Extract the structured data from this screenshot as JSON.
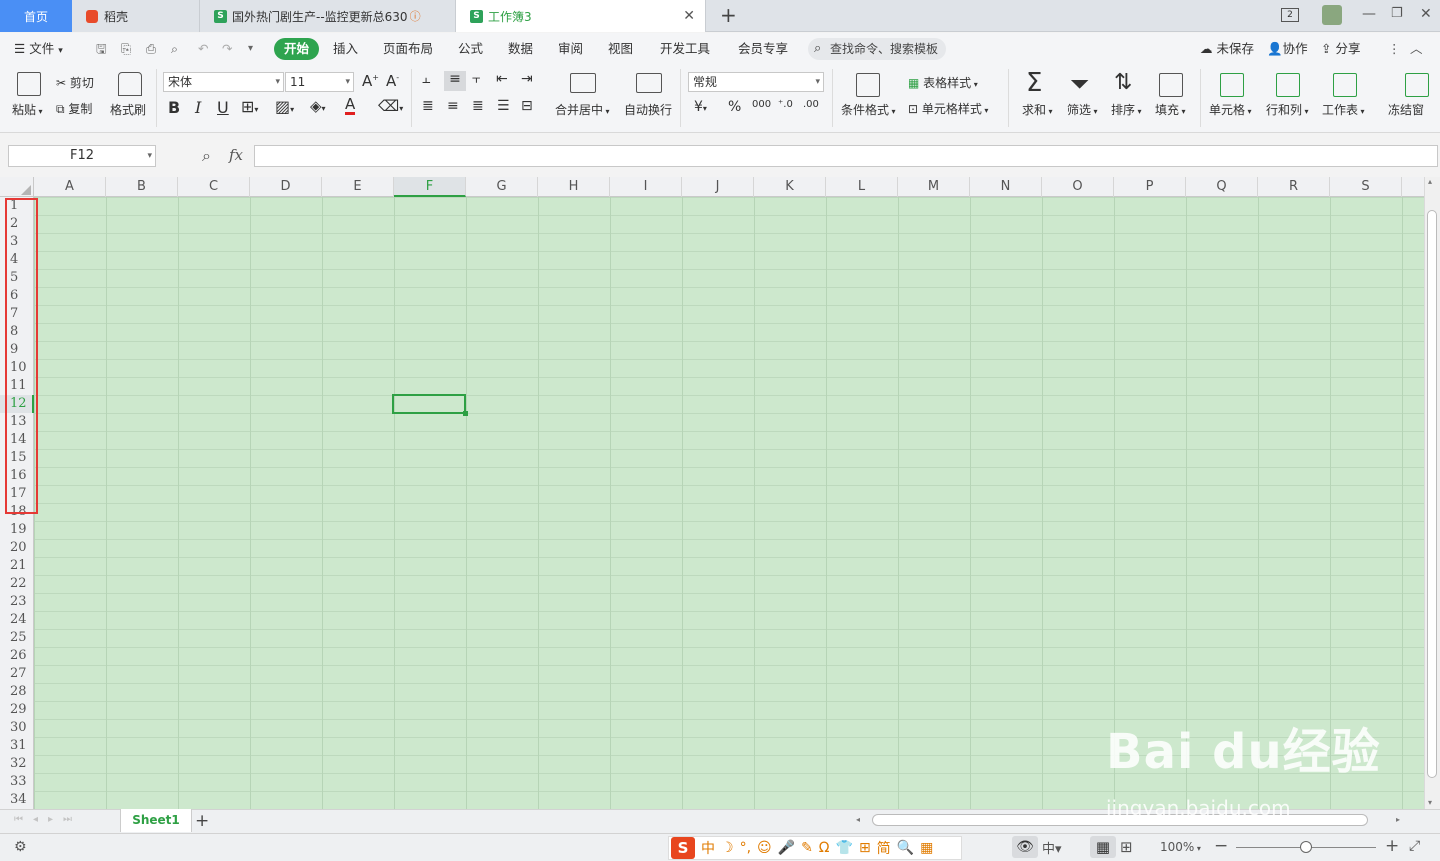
{
  "tabs": {
    "home": "首页",
    "docer": "稻壳",
    "doc1": "国外热门剧生产--监控更新总630",
    "doc2": "工作簿3",
    "add": "+"
  },
  "window": {
    "badge": "2"
  },
  "menu": {
    "file": "文件",
    "items": [
      "开始",
      "插入",
      "页面布局",
      "公式",
      "数据",
      "审阅",
      "视图",
      "开发工具",
      "会员专享"
    ],
    "search": "查找命令、搜索模板",
    "unsaved": "未保存",
    "collab": "协作",
    "share": "分享"
  },
  "ribbon": {
    "paste": "粘贴",
    "cut": "剪切",
    "copy": "复制",
    "format_painter": "格式刷",
    "font_name": "宋体",
    "font_size": "11",
    "merge_center": "合并居中",
    "wrap_text": "自动换行",
    "number_format": "常规",
    "conditional_format": "条件格式",
    "table_style": "表格样式",
    "cell_style": "单元格样式",
    "sum": "求和",
    "filter": "筛选",
    "sort": "排序",
    "fill": "填充",
    "cell": "单元格",
    "row_col": "行和列",
    "worksheet": "工作表",
    "freeze": "冻结窗"
  },
  "formula": {
    "cell_ref": "F12",
    "fx": "fx",
    "value": ""
  },
  "grid": {
    "columns": [
      "A",
      "B",
      "C",
      "D",
      "E",
      "F",
      "G",
      "H",
      "I",
      "J",
      "K",
      "L",
      "M",
      "N",
      "O",
      "P",
      "Q",
      "R",
      "S"
    ],
    "rows": [
      "1",
      "2",
      "3",
      "4",
      "5",
      "6",
      "7",
      "8",
      "9",
      "10",
      "11",
      "12",
      "13",
      "14",
      "15",
      "16",
      "17",
      "18",
      "19",
      "20",
      "21",
      "22",
      "23",
      "24",
      "25",
      "26",
      "27",
      "28",
      "29",
      "30",
      "31",
      "32",
      "33",
      "34"
    ],
    "selected_column": "F",
    "selected_row": "12"
  },
  "sheets": {
    "active": "Sheet1",
    "add": "+"
  },
  "status": {
    "zoom": "100%",
    "ime_logo": "S",
    "ime_items": [
      "中",
      "☽",
      "°,",
      "☺",
      "🎤",
      "✎",
      "Ω",
      "👕",
      "⊞",
      "简",
      "🔍",
      "▦"
    ]
  },
  "watermark": {
    "brand": "Bai du经验",
    "url": "jingyan.baidu.com"
  },
  "colors": {
    "accent": "#2ea044",
    "home_tab": "#4a8ff5",
    "cells_bg": "#cde8cd",
    "highlight": "#e53935"
  }
}
